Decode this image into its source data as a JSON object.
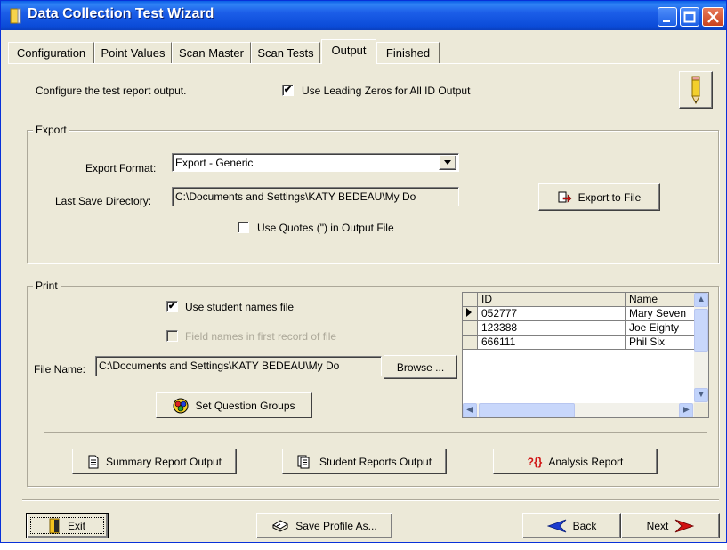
{
  "window": {
    "title": "Data Collection Test Wizard"
  },
  "tabs": [
    {
      "label": "Configuration"
    },
    {
      "label": "Point Values"
    },
    {
      "label": "Scan Master"
    },
    {
      "label": "Scan Tests"
    },
    {
      "label": "Output",
      "active": true
    },
    {
      "label": "Finished"
    }
  ],
  "header": {
    "description": "Configure the test report output.",
    "leading_zeros_label": "Use Leading Zeros for All ID Output",
    "leading_zeros_checked": true
  },
  "export": {
    "group_title": "Export",
    "format_label": "Export Format:",
    "format_value": "Export - Generic",
    "dir_label": "Last Save Directory:",
    "dir_value": "C:\\Documents and Settings\\KATY BEDEAU\\My Do",
    "export_button": "Export to File",
    "quotes_label": "Use Quotes (\") in Output File",
    "quotes_checked": false
  },
  "print": {
    "group_title": "Print",
    "student_names_label": "Use student names file",
    "student_names_checked": true,
    "field_names_label": "Field names in first record of file",
    "field_names_checked": false,
    "file_name_label": "File Name:",
    "file_name_value": "C:\\Documents and Settings\\KATY BEDEAU\\My Do",
    "browse_button": "Browse ...",
    "question_groups_button": "Set Question Groups",
    "grid": {
      "columns": [
        "ID",
        "Name"
      ],
      "rows": [
        {
          "id": "052777",
          "name": "Mary Seven"
        },
        {
          "id": "123388",
          "name": "Joe Eighty"
        },
        {
          "id": "666111",
          "name": "Phil Six"
        }
      ]
    },
    "summary_button": "Summary Report Output",
    "student_reports_button": "Student Reports Output",
    "analysis_button": "Analysis Report",
    "analysis_prefix": "?{}"
  },
  "footer": {
    "exit_button": "Exit",
    "save_profile_button": "Save Profile As...",
    "back_button": "Back",
    "next_button": "Next"
  },
  "colors": {
    "titlebar": "#0a5ee6",
    "face": "#ece9d8",
    "arrow_blue": "#1c3ccf",
    "arrow_red": "#d01010"
  },
  "icons": [
    "pencil-icon",
    "export-icon",
    "question-groups-icon",
    "summary-report-icon",
    "student-reports-icon",
    "exit-door-icon",
    "save-profile-icon",
    "back-arrow-icon",
    "next-arrow-icon"
  ]
}
